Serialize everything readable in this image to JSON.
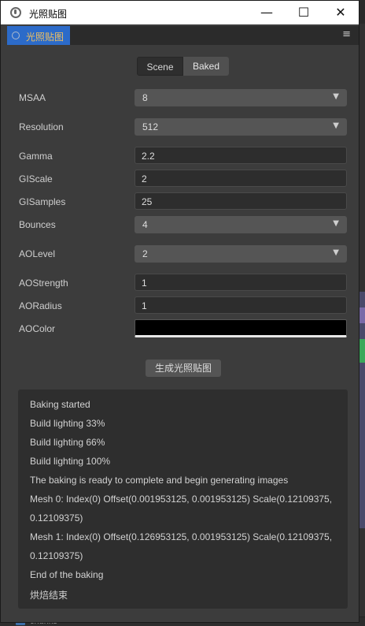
{
  "window": {
    "title": "光照贴图",
    "controls": {
      "minimize": "—",
      "maximize": "☐",
      "close": "✕"
    }
  },
  "tab": {
    "label": "光照贴图",
    "menu_icon": "≡"
  },
  "mode_switch": {
    "options": [
      "Scene",
      "Baked"
    ],
    "selected": "Baked"
  },
  "fields": {
    "msaa": {
      "label": "MSAA",
      "value": "8"
    },
    "resolution": {
      "label": "Resolution",
      "value": "512"
    },
    "gamma": {
      "label": "Gamma",
      "value": "2.2"
    },
    "giscale": {
      "label": "GIScale",
      "value": "2"
    },
    "gisamples": {
      "label": "GISamples",
      "value": "25"
    },
    "bounces": {
      "label": "Bounces",
      "value": "4"
    },
    "aolevel": {
      "label": "AOLevel",
      "value": "2"
    },
    "aostrength": {
      "label": "AOStrength",
      "value": "1"
    },
    "aoradius": {
      "label": "AORadius",
      "value": "1"
    },
    "aocolor": {
      "label": "AOColor",
      "value": "#000000"
    }
  },
  "generate_button": {
    "label": "生成光照贴图"
  },
  "log": {
    "lines": [
      "Baking started",
      "Build lighting 33%",
      "Build lighting 66%",
      "Build lighting 100%",
      "The baking is ready to complete and begin generating images",
      "Mesh 0: Index(0) Offset(0.001953125, 0.001953125) Scale(0.12109375,",
      "0.12109375)",
      "Mesh 1: Index(0) Offset(0.126953125, 0.001953125) Scale(0.12109375,",
      "0.12109375)",
      "End of the baking",
      "烘焙结束"
    ]
  },
  "background": {
    "bottom_item": "chunks"
  },
  "colors": {
    "accent": "#2c6bc9",
    "tab_text": "#f0c060",
    "panel": "#3c3c3c"
  }
}
